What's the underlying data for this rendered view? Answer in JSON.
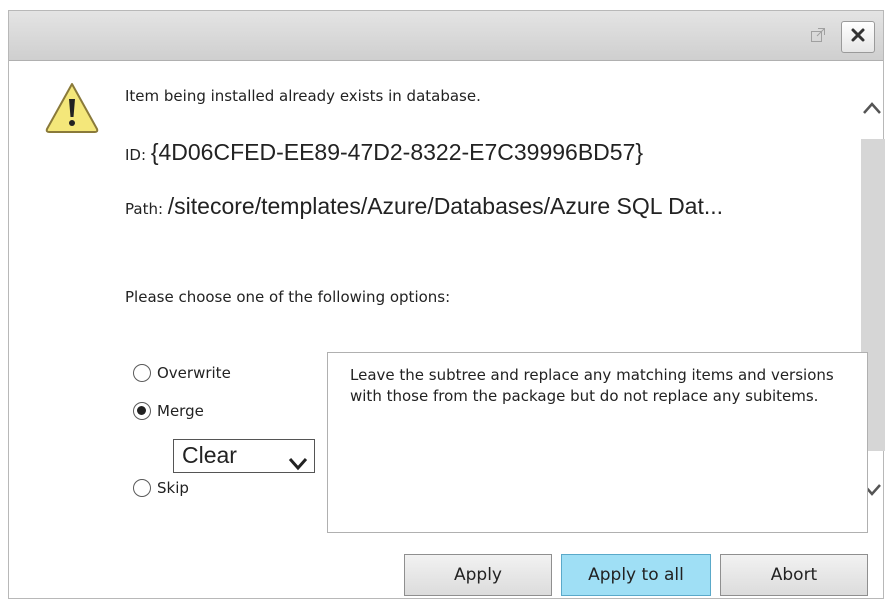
{
  "dialog": {
    "message": "Item being installed already exists in database.",
    "id_label": "ID:",
    "id_value": "{4D06CFED-EE89-47D2-8322-E7C39996BD57}",
    "path_label": "Path:",
    "path_value": "/sitecore/templates/Azure/Databases/Azure SQL Dat...",
    "prompt": "Please choose one of the following options:",
    "options": [
      {
        "label": "Overwrite",
        "checked": false
      },
      {
        "label": "Merge",
        "checked": true
      },
      {
        "label": "Skip",
        "checked": false
      }
    ],
    "merge_mode": "Clear",
    "description": "Leave the subtree and replace any matching items and versions with those from the package but do not replace any subitems.",
    "buttons": {
      "apply": "Apply",
      "apply_all": "Apply to all",
      "abort": "Abort"
    }
  },
  "icons": {
    "warning": "warning-icon",
    "popout": "popout-icon",
    "close": "close-icon",
    "scroll_up": "chevron-up-icon",
    "scroll_down": "chevron-down-icon"
  },
  "colors": {
    "primary_button": "#9fdff5",
    "warning_fill": "#f4e77a"
  }
}
